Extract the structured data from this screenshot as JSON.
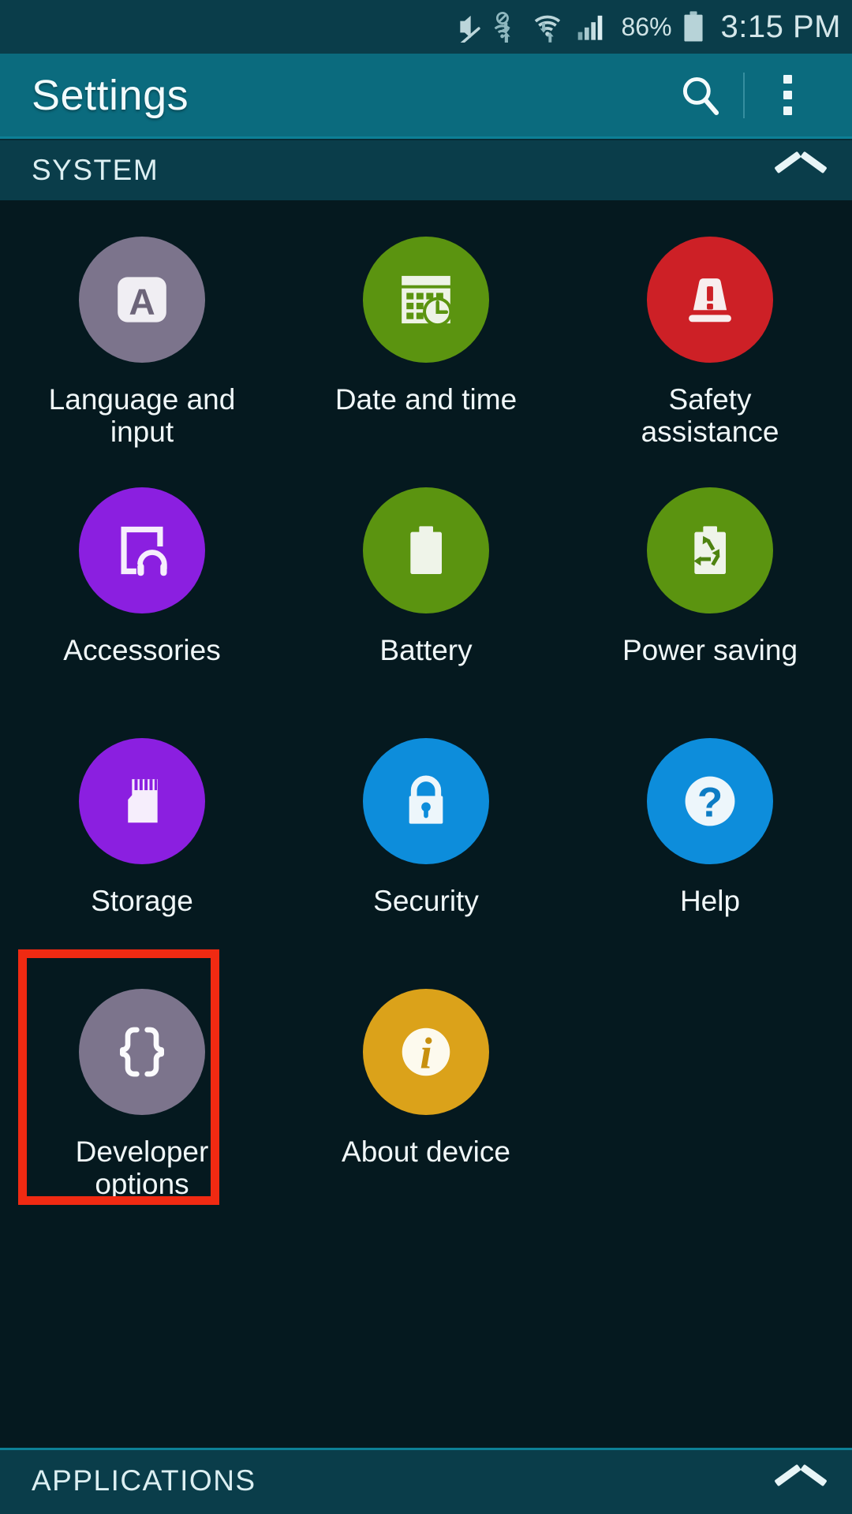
{
  "status_bar": {
    "battery_percent": "86%",
    "time": "3:15 PM",
    "icons": [
      "mute-icon",
      "no-wifi-sync-icon",
      "wifi-icon",
      "signal-bars-icon",
      "battery-icon"
    ]
  },
  "action_bar": {
    "title": "Settings",
    "search_icon": "search-icon",
    "overflow_icon": "overflow-menu-icon"
  },
  "sections": {
    "system": {
      "title": "SYSTEM",
      "collapse_icon": "chevron-up-icon"
    },
    "applications": {
      "title": "APPLICATIONS",
      "collapse_icon": "chevron-up-icon"
    }
  },
  "tiles": [
    {
      "label": "Language and\ninput",
      "icon": "language-input-icon",
      "color": "#7c748c"
    },
    {
      "label": "Date and time",
      "icon": "calendar-clock-icon",
      "color": "#5b9410"
    },
    {
      "label": "Safety\nassistance",
      "icon": "safety-beacon-icon",
      "color": "#cd2026"
    },
    {
      "label": "Accessories",
      "icon": "accessories-icon",
      "color": "#8b1fe0"
    },
    {
      "label": "Battery",
      "icon": "battery-icon",
      "color": "#5b9410"
    },
    {
      "label": "Power saving",
      "icon": "power-saving-icon",
      "color": "#5b9410"
    },
    {
      "label": "Storage",
      "icon": "sd-card-icon",
      "color": "#8b1fe0"
    },
    {
      "label": "Security",
      "icon": "lock-icon",
      "color": "#0d8ddb"
    },
    {
      "label": "Help",
      "icon": "question-mark-icon",
      "color": "#0d8ddb"
    },
    {
      "label": "Developer\noptions",
      "icon": "curly-braces-icon",
      "color": "#7c748c"
    },
    {
      "label": "About device",
      "icon": "info-icon",
      "color": "#dba21a"
    }
  ],
  "highlight": {
    "target": "Developer options",
    "color": "#f02a12"
  },
  "colors": {
    "status_bar_bg": "#0a3d4a",
    "action_bar_bg": "#0b6b7e",
    "page_bg": "#05191f",
    "section_bg": "#0a3d4a",
    "text": "#f0f7f8"
  }
}
